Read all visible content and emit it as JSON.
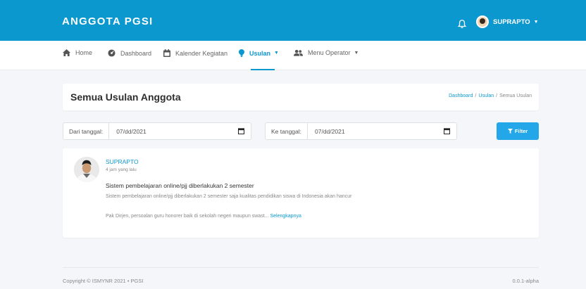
{
  "header": {
    "brand": "ANGGOTA PGSI",
    "user_name": "SUPRAPTO",
    "bg_color": "#0b98cf"
  },
  "nav": {
    "items": [
      {
        "label": "Home",
        "icon": "home-icon"
      },
      {
        "label": "Dashboard",
        "icon": "dashboard-icon"
      },
      {
        "label": "Kalender Kegiatan",
        "icon": "calendar-icon"
      },
      {
        "label": "Usulan",
        "icon": "lightbulb-icon",
        "active": true
      },
      {
        "label": "Menu Operator",
        "icon": "users-icon"
      }
    ]
  },
  "page": {
    "title": "Semua Usulan Anggota",
    "breadcrumb": [
      "Dashboard",
      "Usulan",
      "Semua Usulan"
    ]
  },
  "filter": {
    "from_label": "Dari tanggal:",
    "from_value": "07/dd/2021",
    "to_label": "Ke tanggal:",
    "to_value": "07/dd/2021",
    "button_label": "Filter"
  },
  "post": {
    "author": "SUPRAPTO",
    "time": "4 jam yang lalu",
    "title": "Sistem pembelajaran online/pjj diberlakukan 2 semester",
    "excerpt": "Sistem pembelajaran online/pjj diberlakukan 2 semester saja kualitas pendidikan siswa di Indonesia akan hancur",
    "more_text": "Pak Dirjen,  persoalan guru honorer baik di sekolah negeri maupun swast...",
    "more_link": "Selengkapnya"
  },
  "footer": {
    "copyright": "Copyright © ISMYNR 2021  •  PGSI",
    "version": "0.0.1-alpha"
  }
}
